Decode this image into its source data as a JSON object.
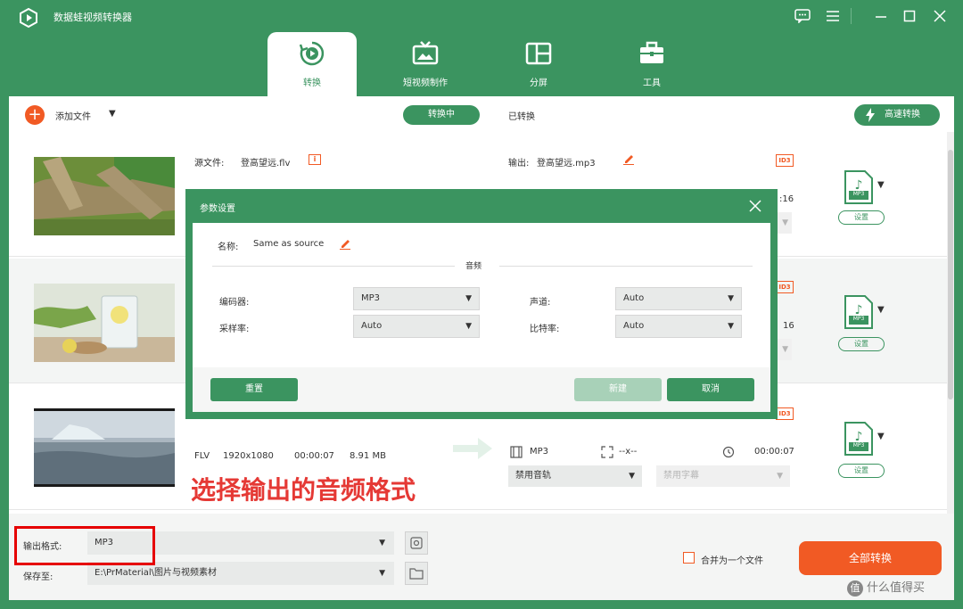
{
  "app": {
    "title": "数据蛙视频转换器"
  },
  "tabs": [
    {
      "label": "转换",
      "icon": "convert-icon"
    },
    {
      "label": "短视频制作",
      "icon": "tv-icon"
    },
    {
      "label": "分屏",
      "icon": "split-screen-icon"
    },
    {
      "label": "工具",
      "icon": "toolbox-icon"
    }
  ],
  "toolbar": {
    "add_file": "添加文件",
    "converting": "转换中",
    "converted": "已转换",
    "fast_convert": "高速转换"
  },
  "files": [
    {
      "source_label": "源文件:",
      "source_name": "登高望远.flv",
      "output_label": "输出:",
      "output_name": "登高望远.mp3",
      "duration_tail": ":16",
      "badge": "ID3",
      "format": "MP3",
      "settings": "设置"
    },
    {
      "duration_tail": "16",
      "badge": "ID3",
      "format": "MP3",
      "settings": "设置"
    },
    {
      "container": "FLV",
      "resolution": "1920x1080",
      "duration": "00:00:07",
      "size": "8.91 MB",
      "out_format": "MP3",
      "out_res": "--x--",
      "out_duration": "00:00:07",
      "audio_track": "禁用音轨",
      "subtitle": "禁用字幕",
      "badge": "ID3",
      "format": "MP3",
      "settings": "设置"
    }
  ],
  "annotation": "选择输出的音频格式",
  "bottom": {
    "output_format_label": "输出格式:",
    "output_format_value": "MP3",
    "save_to_label": "保存至:",
    "save_to_path": "E:\\PrMaterial\\图片与视频素材",
    "merge_label": "合并为一个文件",
    "convert_all": "全部转换"
  },
  "dialog": {
    "title": "参数设置",
    "name_label": "名称:",
    "name_value": "Same as source",
    "section": "音频",
    "encoder_label": "编码器:",
    "encoder_value": "MP3",
    "channel_label": "声道:",
    "channel_value": "Auto",
    "samplerate_label": "采样率:",
    "samplerate_value": "Auto",
    "bitrate_label": "比特率:",
    "bitrate_value": "Auto",
    "reset": "重置",
    "new": "新建",
    "cancel": "取消"
  },
  "watermark": "什么值得买",
  "colors": {
    "brand_green": "#3b9460",
    "accent_orange": "#f15a24",
    "highlight_red": "#e60000"
  }
}
